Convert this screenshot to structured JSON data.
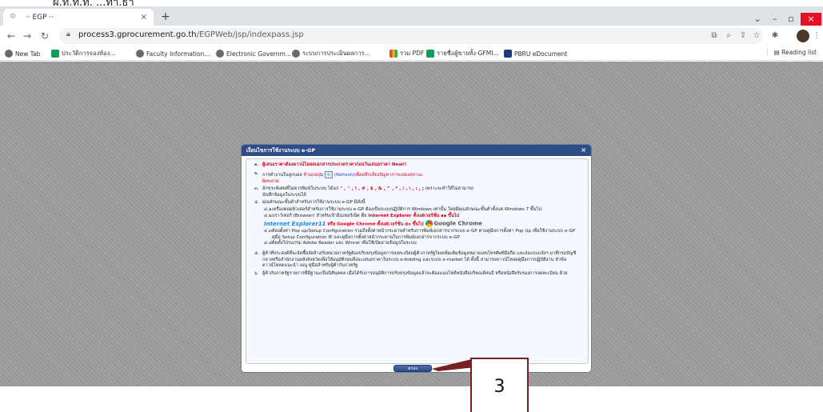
{
  "caption": "ผ.ท.ท.ทุ. ...ทา.ธา",
  "browser": {
    "tab_title": "‎ ·· EGP ··",
    "tab_close": "×",
    "new_tab": "+",
    "url_host": "process3.gprocurement.go.th",
    "url_path": "/EGPWeb/jsp/indexpass.jsp",
    "win_min": "–",
    "win_max": "▫",
    "win_close": "×"
  },
  "bookmarks": [
    {
      "label": "New Tab",
      "icon": "globe-icon",
      "color": "grey"
    },
    {
      "label": "ประวัติการจองห้อง...",
      "icon": "sheets-icon",
      "color": "green"
    },
    {
      "label": "Faculty Information...",
      "icon": "globe-icon",
      "color": "grey"
    },
    {
      "label": "Electronic Governm...",
      "icon": "egp-icon",
      "color": "grey"
    },
    {
      "label": "ระบบการประเมินผลการ...",
      "icon": "globe-icon",
      "color": "grey"
    },
    {
      "label": "รวม PDF",
      "icon": "multi-icon",
      "color": "multi"
    },
    {
      "label": "รายชื่อผู้ขายทั้ง-GFMI...",
      "icon": "sheets-icon",
      "color": "green"
    },
    {
      "label": "PBRU eDocument",
      "icon": "doc-icon",
      "color": "navy"
    }
  ],
  "reading_list": "Reading list",
  "modal": {
    "title": "เงื่อนไขการใช้งานระบบ e-GP",
    "close": "×",
    "items": [
      {
        "num": "๑.",
        "text": "ผู้เสนอราคาต้องดาวน์โหลดเอกสารประกวดราคาก่อนวันเสนอราคา",
        "badge": "New!!"
      },
      {
        "num": "๒.",
        "text_a": "การทำงานในลูกบอล",
        "text_b": "ห้ามกดปุ่ม",
        "text_c": "(Refresh)",
        "text_d": "เพื่อหลีกเลี่ยงปัญหาการแสดงสถานะ",
        "text_e": "ผิดพลาด"
      },
      {
        "num": "๓.",
        "text_a": "อักขระพิเศษที่ไม่ควรพิมพ์ในระบบ ได้แก่",
        "chars": "\" , '' , ! , # , $ , & , ^ , * , / , \\ , : , ;",
        "text_b": "เพราะจะทำให้ไม่สามารถ",
        "text_c": "บันทึกข้อมูลในระบบได้"
      },
      {
        "num": "๔.",
        "text": "คุณลักษณะขั้นต่ำสำหรับการใช้งานระบบ e-GP มีดังนี้"
      }
    ],
    "sub_items": [
      {
        "num": "๔.๑",
        "text": "เครื่องคอมพิวเตอร์สำหรับการใช้งานระบบ e-GP ต้องเป็นระบบปฏิบัติการ Windows เท่านั้น โดยมีคุณลักษณะขั้นต่ำตั้งแต่ Windows 7 ขึ้นไป"
      },
      {
        "num": "๔.๒",
        "text_a": "บราว์เซอร์ (Browser) สำหรับเข้าอินเทอร์เน็ต คือ",
        "text_b": "Internet Explorer ตั้งแต่เวอร์ชั่น ๑๑ ขึ้นไป"
      },
      {
        "ie_label": "Internet Explorer11",
        "text": "หรือ Google Chrome ตั้งแต่เวอร์ชั่น ๕๐ ขึ้นไป",
        "gc_label": "Google Chrome"
      },
      {
        "num": "๔.๓",
        "text": "ต้องตั้งค่า Pop up/Setup Configuration รวมถึงตั้งค่าหน้ากระดาษสำหรับการพิมพ์เอกสารจากระบบ e-GP ตามคู่มือการตั้งค่า Pop Up เพื่อใช้งานระบบ e-GP คู่มือ Setup Configuration IE และคู่มือการตั้งค่าหน้ากระดาษในการพิมพ์เอกสารจากระบบ e-GP"
      },
      {
        "num": "๔.๔",
        "text": "ติดตั้งโปรแกรม Adobe Reader และ Winrar เพื่อใช้เปิดอ่านข้อมูลในระบบ"
      }
    ],
    "items2": [
      {
        "num": "๕.",
        "text": "ผู้ค้าที่ประสงค์ที่จะจัดซื้อจัดจ้างกับหน่วยภาครัฐต้องปรับปรุงข้อมูลการลงทะเบียนผู้ค้าภาครัฐโดยเพิ่มเติมข้อมูลหมายเลขโทรศัพท์มือถือ และส่งแบบแจ้งฯ มาที่กรมบัญชีกลางหรือสำนักงานคลังจังหวัดเพื่อให้อนุมัติก่อนจึงจะเสนอราคาในระบบ e-bidding และระบบ e-market ได้ ทั้งนี้ สามารถดาวน์โหลดคู่มือการปฏิบัติงาน หัวข้อดาวน์โหลดแนะนำ เมนู คู่มือสำหรับผู้ค้ากับภาครัฐ"
      },
      {
        "num": "๖.",
        "text": "ผู้ค้ากับภาครัฐรายการที่มีฐานะเป็นนิติบุคคล เมื่อได้รับการอนุมัติการปรับปรุงข้อมูลแล้วจะต้องแนบไฟล์หนังสือบริคณห์สนธิ หรือหนังสือรับรองการจดทะเบียน ด้วย"
      }
    ],
    "ok_button": "ตกลง"
  },
  "annotation": {
    "number": "3",
    "color": "#7a1f1f"
  }
}
